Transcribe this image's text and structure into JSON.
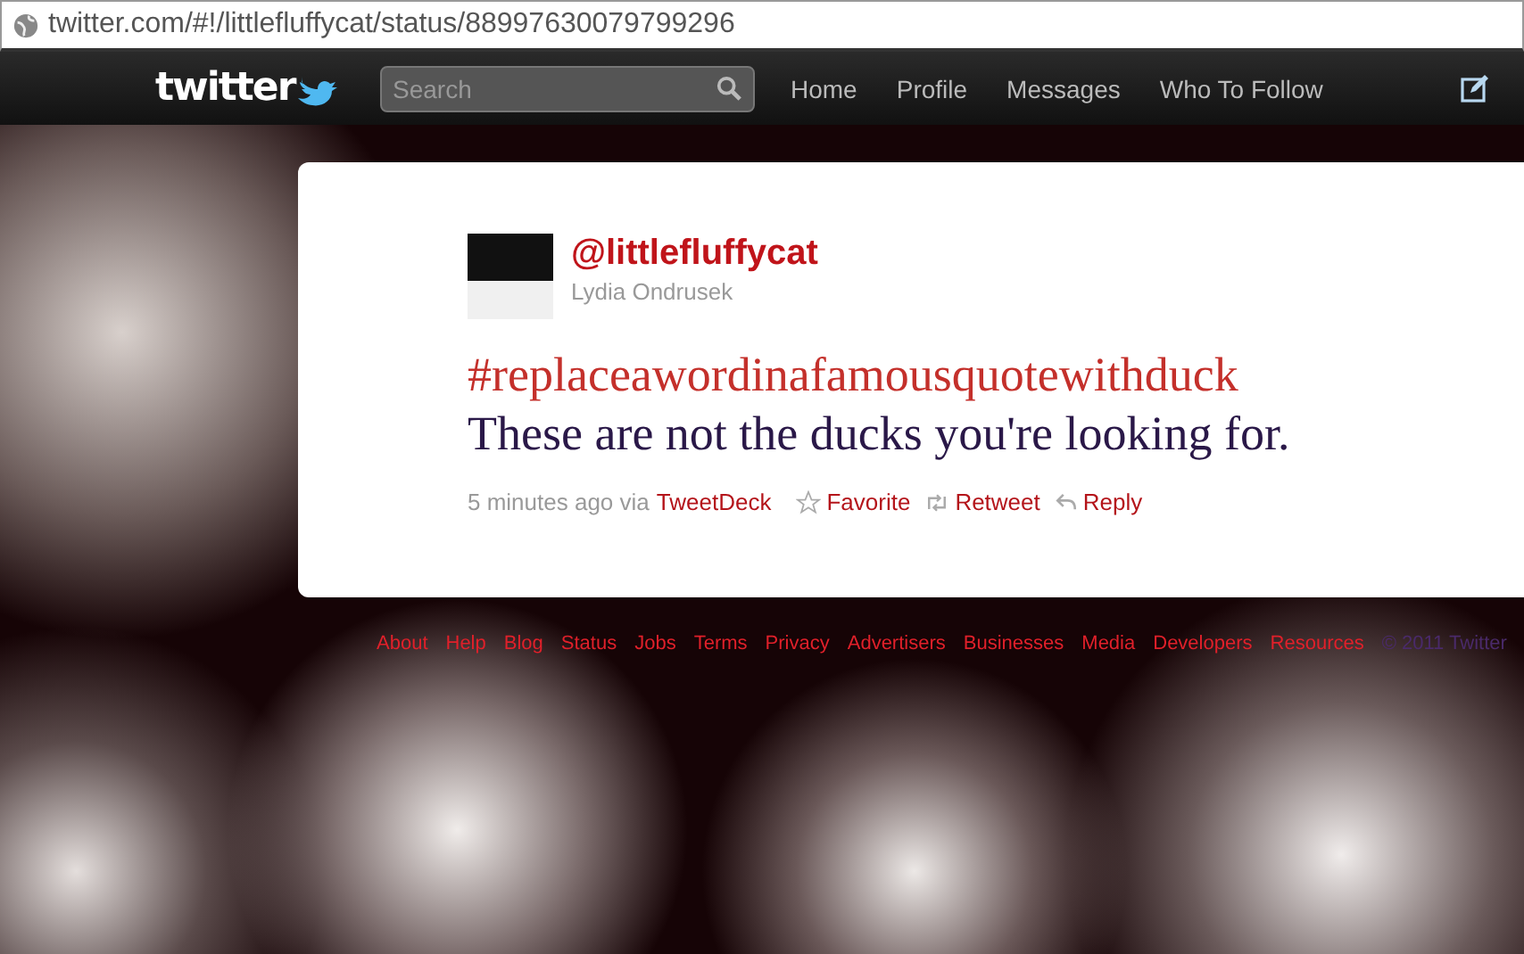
{
  "address_bar": {
    "url": "twitter.com/#!/littlefluffycat/status/88997630079799296"
  },
  "top_bar": {
    "logo": "twitter",
    "search": {
      "placeholder": "Search"
    },
    "nav": [
      {
        "label": "Home"
      },
      {
        "label": "Profile"
      },
      {
        "label": "Messages"
      },
      {
        "label": "Who To Follow"
      }
    ]
  },
  "tweet": {
    "handle": "@littlefluffycat",
    "name": "Lydia Ondrusek",
    "hashtag": "#replaceawordinafamousquotewithduck",
    "text": "These are not the ducks you're looking for.",
    "time": "5 minutes ago via",
    "source": "TweetDeck",
    "actions": [
      {
        "kind": "favorite",
        "label": "Favorite"
      },
      {
        "kind": "retweet",
        "label": "Retweet"
      },
      {
        "kind": "reply",
        "label": "Reply"
      }
    ]
  },
  "footer": {
    "links": [
      "About",
      "Help",
      "Blog",
      "Status",
      "Jobs",
      "Terms",
      "Privacy",
      "Advertisers",
      "Businesses",
      "Media",
      "Developers",
      "Resources"
    ],
    "copyright": "© 2011 Twitter"
  }
}
